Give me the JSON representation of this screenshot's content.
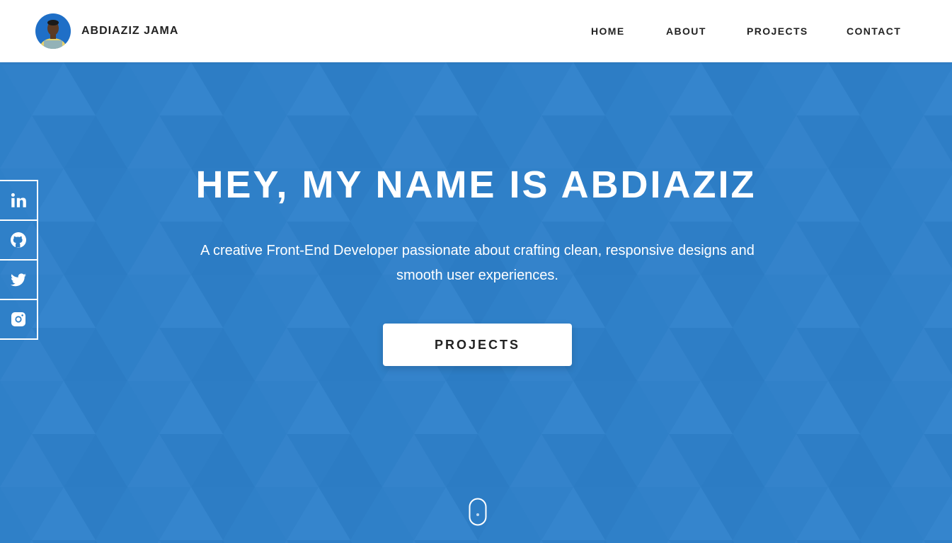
{
  "header": {
    "brand_name": "ABDIAZIZ JAMA",
    "nav": {
      "home": "HOME",
      "about": "ABOUT",
      "projects": "PROJECTS",
      "contact": "CONTACT"
    }
  },
  "social": {
    "icons": [
      "linkedin-icon",
      "github-icon",
      "twitter-icon",
      "instagram-icon"
    ]
  },
  "hero": {
    "title": "HEY, MY NAME IS ABDIAZIZ",
    "subtitle": "A creative Front-End Developer passionate about crafting clean, responsive designs and smooth user experiences.",
    "cta_label": "PROJECTS"
  },
  "colors": {
    "hero_bg": "#2f80c8",
    "header_bg": "#ffffff",
    "text_dark": "#222222"
  }
}
